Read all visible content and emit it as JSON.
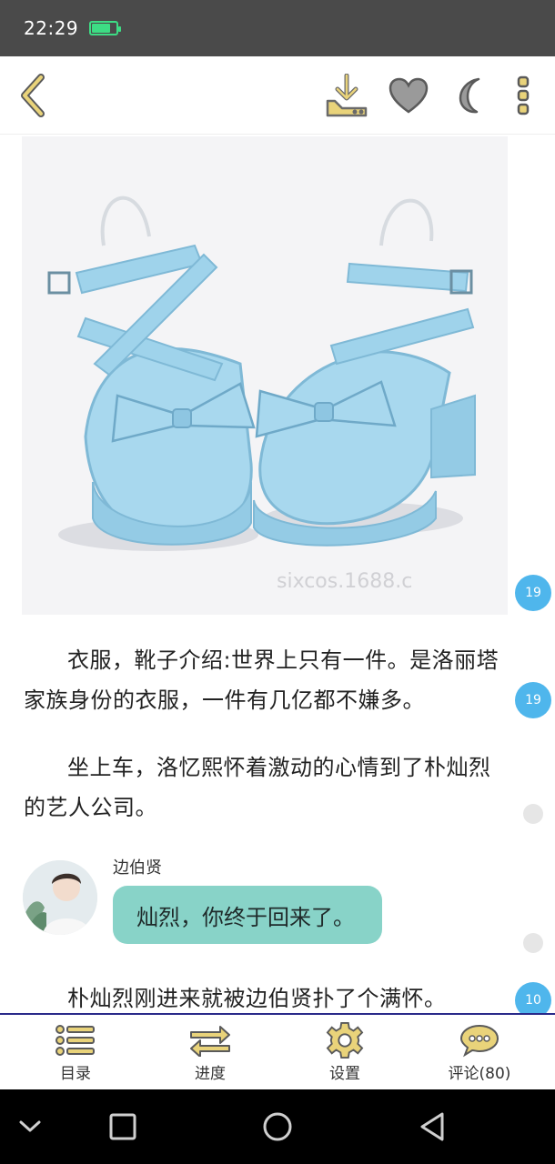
{
  "status_bar": {
    "time": "22:29",
    "battery_level": 0.75,
    "battery_color": "#3ddc84"
  },
  "toolbar": {
    "icons": [
      "back-chevron-icon",
      "download-icon",
      "heart-icon",
      "moon-icon",
      "more-vertical-icon"
    ],
    "accent": "#e9d37a"
  },
  "content": {
    "image": {
      "subject": "light blue mary-jane platform shoes with bows",
      "watermark": "sixcos.1688.c"
    },
    "paragraphs": [
      {
        "text": "衣服，靴子介绍:世界上只有一件。是洛丽塔家族身份的衣服，一件有几亿都不嫌多。"
      },
      {
        "text": "坐上车，洛忆熙怀着激动的心情到了朴灿烈的艺人公司。"
      },
      {
        "text": "朴灿烈刚进来就被边伯贤扑了个满怀。"
      }
    ],
    "dialogue": {
      "speaker": "边伯贤",
      "text": "灿烈，你终于回来了。",
      "bubble_color": "#88d3c8"
    },
    "comment_badges": [
      "19",
      "19",
      "",
      "",
      "10"
    ],
    "badge_color": "#4fb6ec"
  },
  "tab_bar": {
    "tabs": [
      {
        "label": "目录",
        "icon": "list-icon"
      },
      {
        "label": "进度",
        "icon": "progress-arrows-icon"
      },
      {
        "label": "设置",
        "icon": "settings-gear-icon"
      },
      {
        "label": "评论(80)",
        "icon": "comment-bubble-icon"
      }
    ]
  },
  "nav_bar": {
    "icons": [
      "collapse-chevron-icon",
      "recent-apps-icon",
      "home-icon",
      "back-icon"
    ]
  }
}
